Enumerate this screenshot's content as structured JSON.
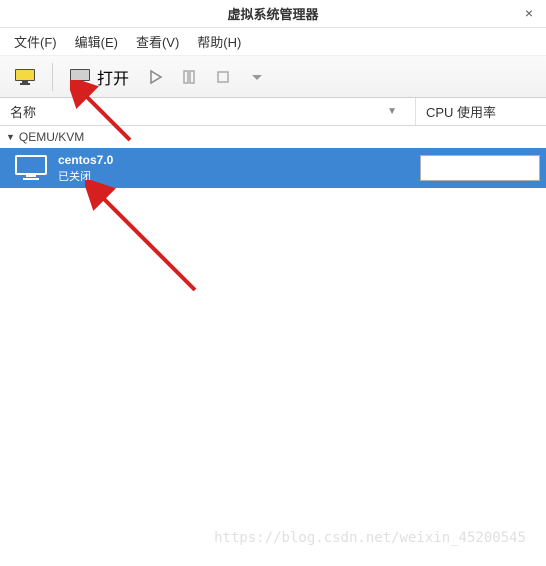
{
  "titlebar": {
    "title": "虚拟系统管理器",
    "close": "×"
  },
  "menu": {
    "file": "文件(F)",
    "edit": "编辑(E)",
    "view": "查看(V)",
    "help": "帮助(H)"
  },
  "toolbar": {
    "open_label": "打开"
  },
  "columns": {
    "name": "名称",
    "cpu": "CPU 使用率"
  },
  "connection": {
    "label": "QEMU/KVM"
  },
  "vm": {
    "name": "centos7.0",
    "status": "已关闭"
  },
  "watermark": "https://blog.csdn.net/weixin_45200545"
}
